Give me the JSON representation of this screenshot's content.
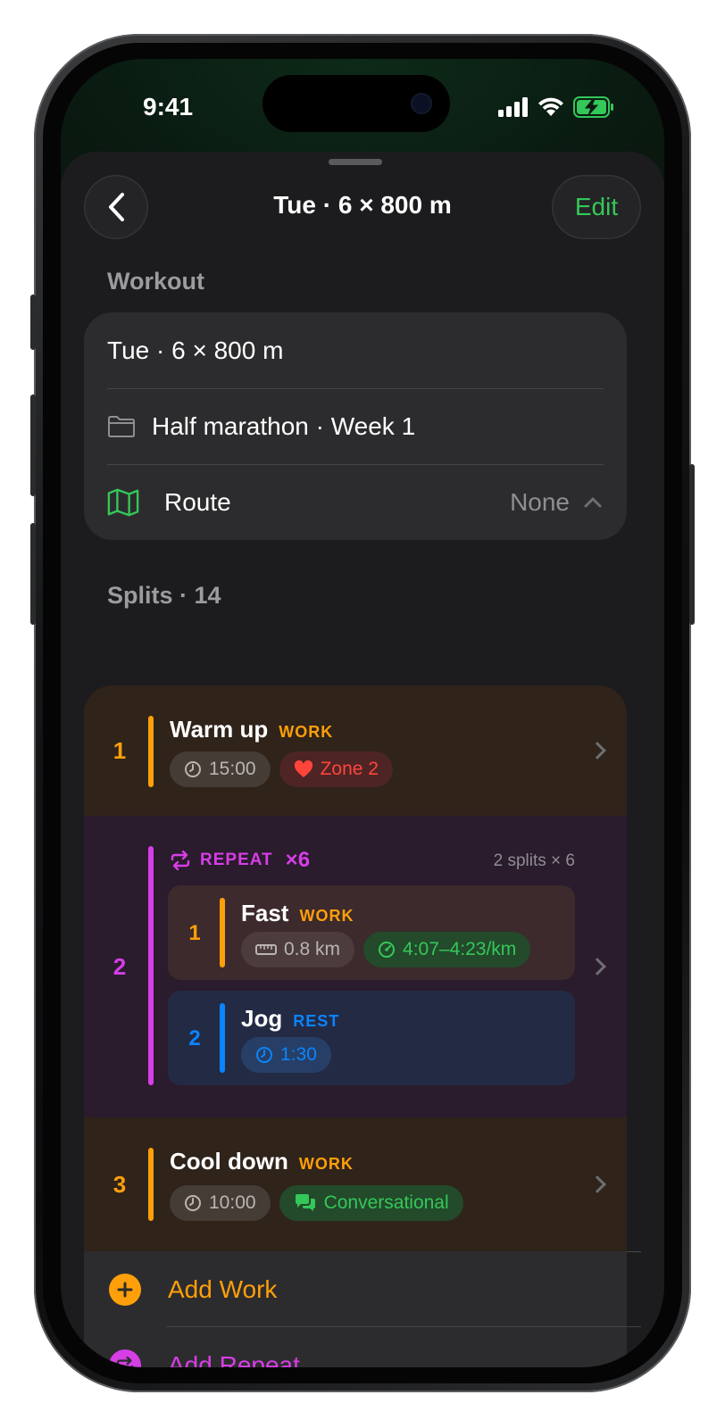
{
  "status_bar": {
    "time": "9:41"
  },
  "nav": {
    "title": "Tue · 6 × 800 m",
    "edit_label": "Edit"
  },
  "workout_section": {
    "label": "Workout",
    "name": "Tue · 6 × 800 m",
    "plan": "Half marathon · Week 1",
    "route_label": "Route",
    "route_value": "None"
  },
  "splits_section": {
    "label": "Splits · 14",
    "items": [
      {
        "number": "1",
        "title": "Warm up",
        "tag": "WORK",
        "duration": "15:00",
        "target": "Zone 2"
      },
      {
        "number": "2",
        "repeat_label": "REPEAT",
        "repeat_count": "×6",
        "summary": "2 splits × 6",
        "steps": [
          {
            "number": "1",
            "title": "Fast",
            "tag": "WORK",
            "distance": "0.8 km",
            "pace": "4:07–4:23/km"
          },
          {
            "number": "2",
            "title": "Jog",
            "tag": "REST",
            "duration": "1:30"
          }
        ]
      },
      {
        "number": "3",
        "title": "Cool down",
        "tag": "WORK",
        "duration": "10:00",
        "target": "Conversational"
      }
    ]
  },
  "actions": {
    "add_work": "Add Work",
    "add_repeat": "Add Repeat"
  },
  "colors": {
    "work": "#ff9f0a",
    "rest": "#0a84ff",
    "repeat": "#d63ee6",
    "accent_green": "#34c759",
    "zone_red": "#ff453a"
  }
}
